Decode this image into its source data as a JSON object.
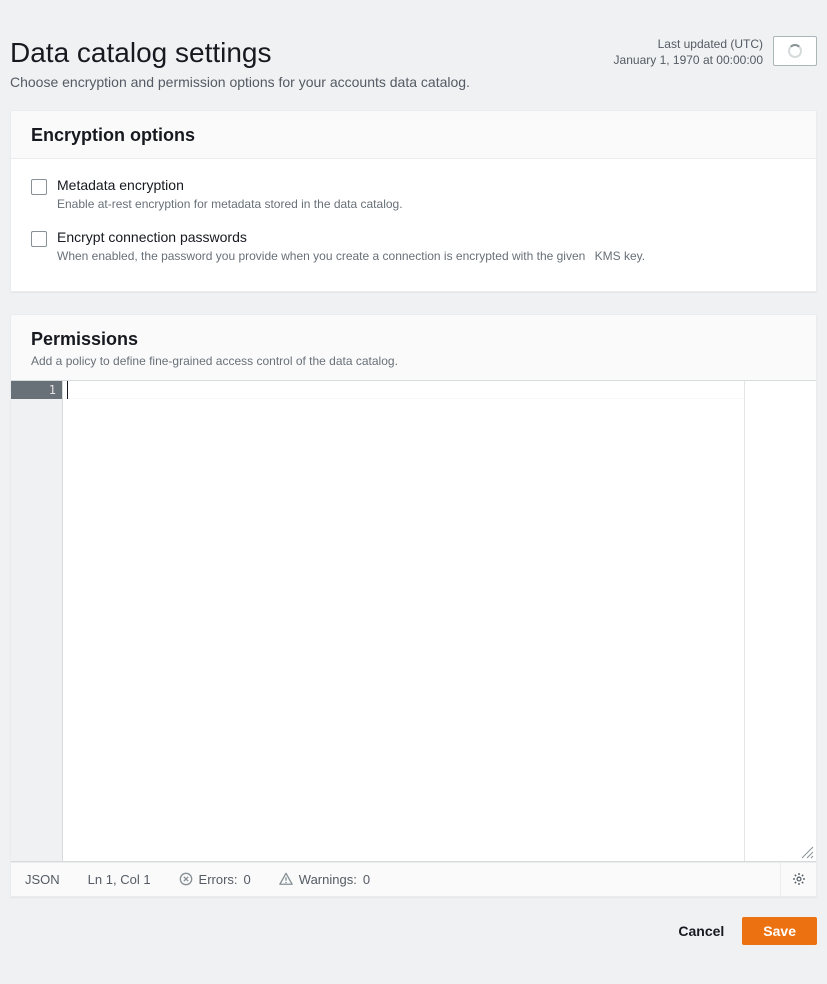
{
  "header": {
    "title": "Data catalog settings",
    "description": "Choose encryption and permission options for your accounts data catalog.",
    "last_updated_label": "Last updated (UTC)",
    "last_updated_value": "January 1, 1970 at 00:00:00"
  },
  "encryption": {
    "panel_title": "Encryption options",
    "metadata": {
      "label": "Metadata encryption",
      "hint": "Enable at-rest encryption for metadata stored in the data catalog."
    },
    "passwords": {
      "label": "Encrypt connection passwords",
      "hint_prefix": "When enabled, the password you provide when you create a connection is encrypted with the given",
      "kms": "KMS key."
    }
  },
  "permissions": {
    "panel_title": "Permissions",
    "panel_description": "Add a policy to define fine-grained access control of the data catalog.",
    "gutter_line": "1",
    "status": {
      "language": "JSON",
      "position": "Ln 1, Col 1",
      "errors_label": "Errors:",
      "errors_count": "0",
      "warnings_label": "Warnings:",
      "warnings_count": "0"
    }
  },
  "footer": {
    "cancel": "Cancel",
    "save": "Save"
  }
}
